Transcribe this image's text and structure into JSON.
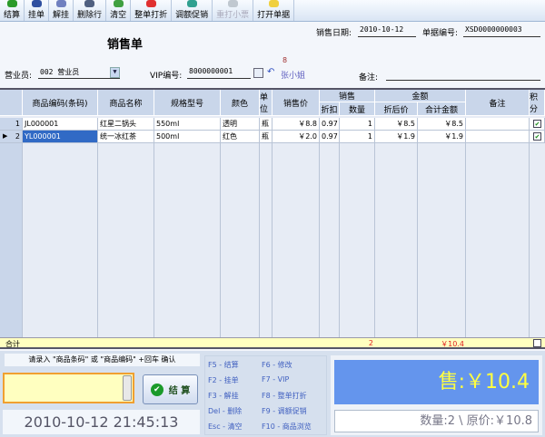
{
  "toolbar": [
    {
      "label": "结算",
      "icon": "check-icon",
      "color": "#2a9a2a",
      "enabled": true
    },
    {
      "label": "挂单",
      "icon": "save-icon",
      "color": "#3050a0",
      "enabled": true
    },
    {
      "label": "解挂",
      "icon": "book-icon",
      "color": "#7080c0",
      "enabled": true
    },
    {
      "label": "删除行",
      "icon": "delete-row-icon",
      "color": "#506080",
      "enabled": true
    },
    {
      "label": "清空",
      "icon": "refresh-icon",
      "color": "#40a040",
      "enabled": true
    },
    {
      "label": "整单打折",
      "icon": "heart-icon",
      "color": "#e03030",
      "enabled": true
    },
    {
      "label": "调额促销",
      "icon": "box-icon",
      "color": "#30a090",
      "enabled": true
    },
    {
      "label": "重打小票",
      "icon": "printer-icon",
      "color": "#c0c8d0",
      "enabled": false
    },
    {
      "label": "打开单据",
      "icon": "folder-icon",
      "color": "#f0d040",
      "enabled": true
    }
  ],
  "form": {
    "title": "销售单",
    "date_label": "销售日期:",
    "date": "2010-10-12",
    "no_label": "单据编号:",
    "no": "XSD0000000003",
    "clerk_label": "营业员:",
    "clerk": "002 营业员",
    "vip_label": "VIP编号:",
    "vip": "8000000001",
    "vip_points": "8",
    "vip_name": "张小姐",
    "note_label": "备注:",
    "note": ""
  },
  "grid": {
    "headers": {
      "code": "商品编码(条码)",
      "name": "商品名称",
      "spec": "规格型号",
      "color": "颜色",
      "unit": "单位",
      "price": "销售价",
      "sale": "销售",
      "discount": "折扣",
      "qty": "数量",
      "amount": "金额",
      "disc_price": "折后价",
      "total": "合计金额",
      "remark": "备注",
      "points": "积分"
    },
    "rows": [
      {
        "idx": "1",
        "code": "JL000001",
        "name": "红星二锅头",
        "spec": "550ml",
        "color": "透明",
        "unit": "瓶",
        "price": "￥8.8",
        "discount": "0.97",
        "qty": "1",
        "disc_price": "￥8.5",
        "total": "￥8.5",
        "remark": "",
        "points": true
      },
      {
        "idx": "2",
        "code": "YL000001",
        "name": "统一冰红茶",
        "spec": "500ml",
        "color": "红色",
        "unit": "瓶",
        "price": "￥2.0",
        "discount": "0.97",
        "qty": "1",
        "disc_price": "￥1.9",
        "total": "￥1.9",
        "remark": "",
        "points": true
      }
    ],
    "total_label": "合计",
    "total_qty": "2",
    "total_amount": "￥10.4"
  },
  "bottom": {
    "hint": "请录入 \"商品条码\" 或 \"商品编码\" +回车 确认",
    "input": "",
    "settle": "结 算",
    "datetime": "2010-10-12 21:45:13",
    "shortcuts": [
      "F5 - 结算",
      "F6 - 修改",
      "F2 - 挂单",
      "F7 - VIP",
      "F3 - 解挂",
      "F8 - 整单打折",
      "Del - 删除",
      "F9 - 调额促销",
      "Esc - 清空",
      "F10 - 商品浏览"
    ],
    "sale": "售:￥10.4",
    "summary": "数量:2 \\ 原价:￥10.8"
  }
}
